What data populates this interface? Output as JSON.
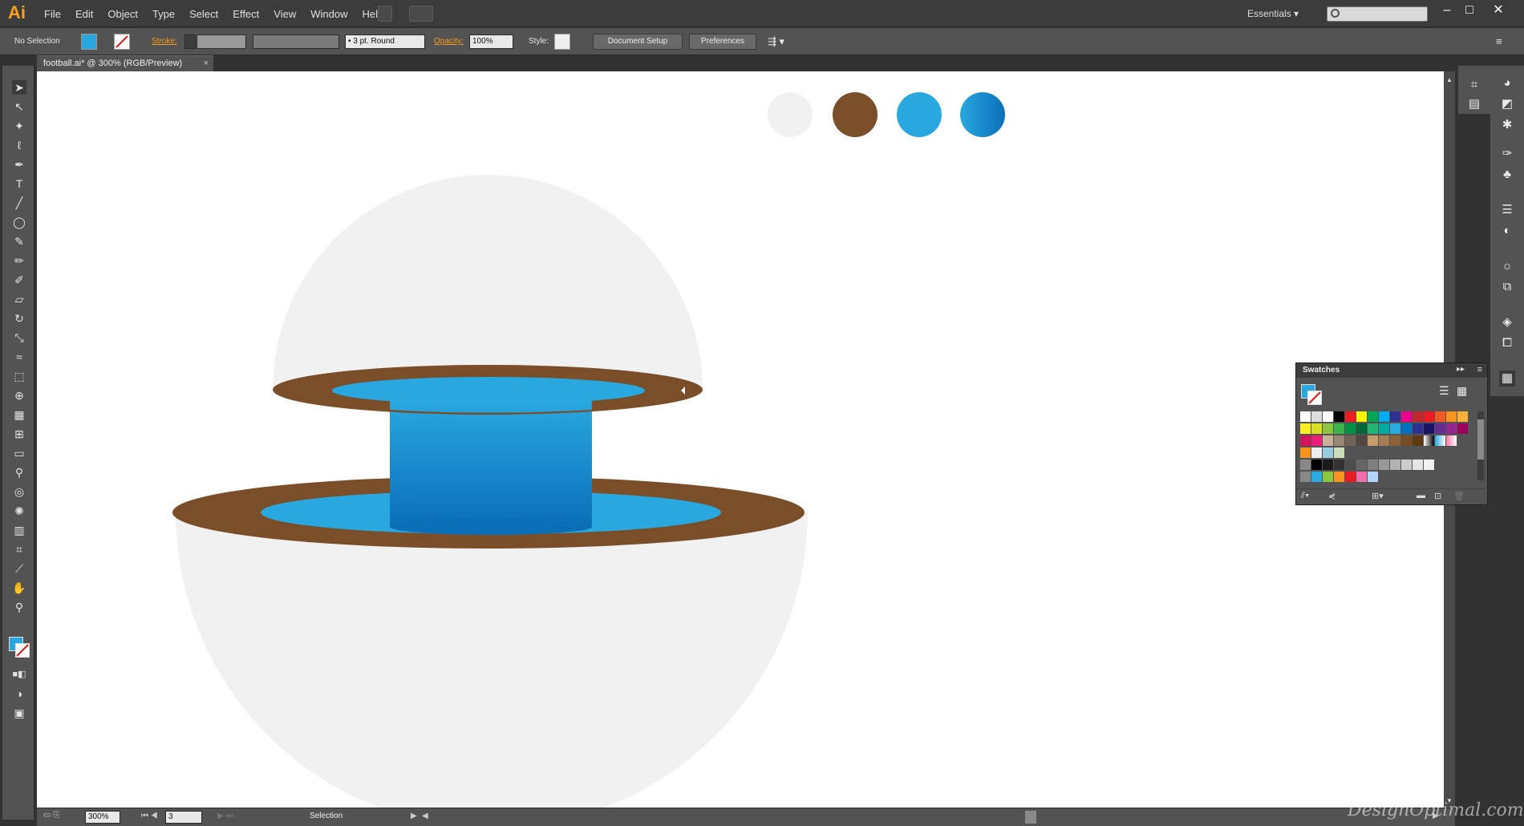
{
  "app": {
    "logo": "Ai",
    "menu": [
      "File",
      "Edit",
      "Object",
      "Type",
      "Select",
      "Effect",
      "View",
      "Window",
      "Help"
    ],
    "workspace": "Essentials",
    "window_controls": [
      "minimize-icon",
      "restore-icon",
      "close-icon"
    ]
  },
  "control_bar": {
    "selection": "No Selection",
    "stroke_label": "Stroke:",
    "brush": "3 pt. Round",
    "opacity_label": "Opacity:",
    "opacity_value": "100%",
    "style_label": "Style:",
    "document_setup": "Document Setup",
    "preferences": "Preferences"
  },
  "document": {
    "tab": "football.ai* @ 300% (RGB/Preview)",
    "close": "×"
  },
  "status": {
    "zoom": "300%",
    "page": "3",
    "mode": "Selection"
  },
  "swatches_panel": {
    "title": "Swatches"
  },
  "colors": {
    "light_gray": "#f1f1f1",
    "brown": "#7a4e28",
    "sky_blue": "#29a8e0",
    "blue_gradient_start": "#29a8e0",
    "blue_gradient_end": "#0b6fb8",
    "accent": "#f39a1f"
  },
  "tools": [
    "selection-icon",
    "direct-selection-icon",
    "magic-wand-icon",
    "lasso-icon",
    "pen-icon",
    "type-icon",
    "line-icon",
    "ellipse-icon",
    "paintbrush-icon",
    "pencil-icon",
    "blob-brush-icon",
    "eraser-icon",
    "rotate-icon",
    "scale-icon",
    "warp-icon",
    "free-transform-icon",
    "shape-builder-icon",
    "perspective-icon",
    "mesh-icon",
    "gradient-icon",
    "eyedropper-icon",
    "blend-icon",
    "symbol-sprayer-icon",
    "graph-icon",
    "artboard-icon",
    "slice-icon",
    "hand-icon",
    "zoom-icon"
  ],
  "watermark": "DesignOptimal.com"
}
